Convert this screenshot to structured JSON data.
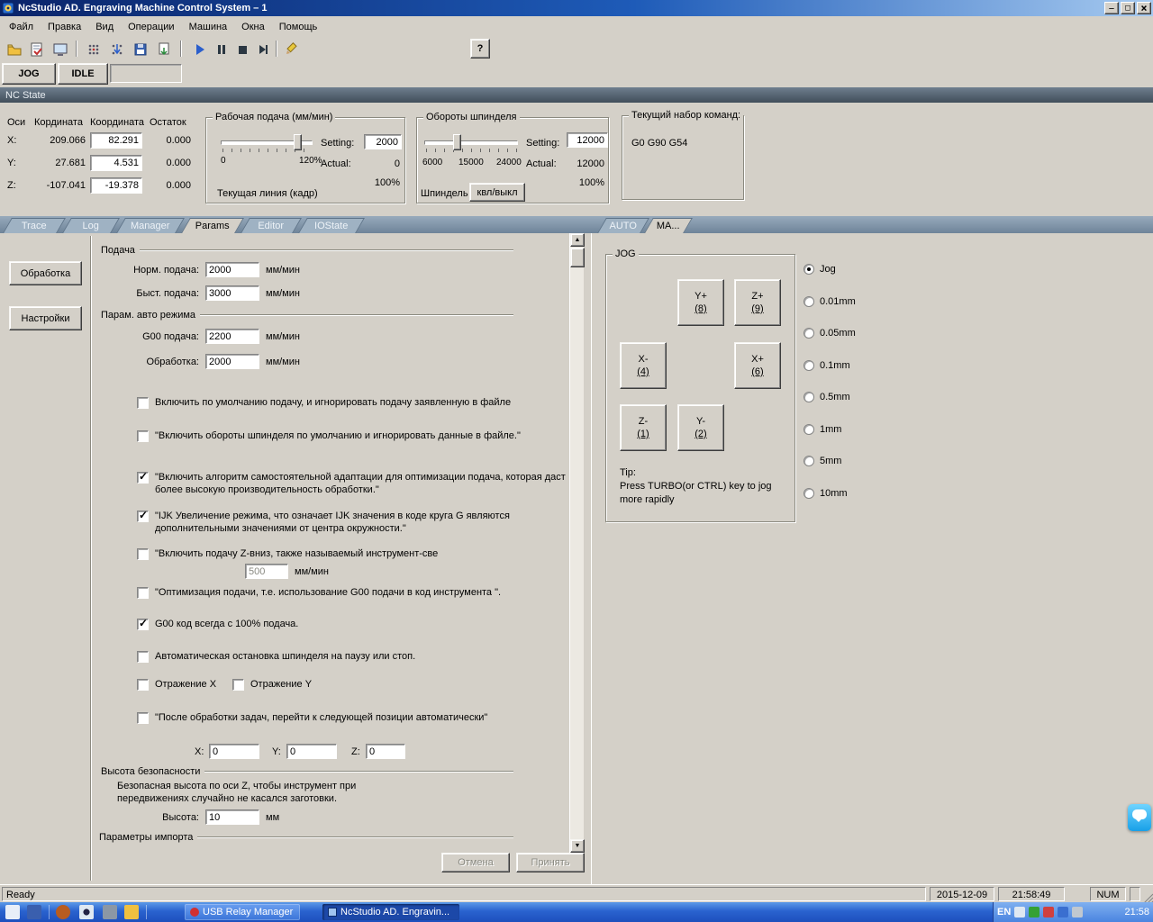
{
  "colors": {
    "titlebar_dark": "#0a246a",
    "titlebar_light": "#a6caf0",
    "ncstate_top": "#6e7e8e",
    "ncstate_bottom": "#414e5a",
    "tab_bar": "#6f8499",
    "taskbar": "#2a63cf"
  },
  "window": {
    "title": "NcStudio AD. Engraving Machine Control System  – 1"
  },
  "menu": {
    "items": [
      {
        "label": "Файл"
      },
      {
        "label": "Правка"
      },
      {
        "label": "Вид"
      },
      {
        "label": "Операции"
      },
      {
        "label": "Машина"
      },
      {
        "label": "Окна"
      },
      {
        "label": "Помощь"
      }
    ]
  },
  "toolbar": {
    "coord_x": "X0",
    "coord_y": "Y",
    "coord_z": "Z",
    "help_label": "?"
  },
  "modes": {
    "jog": "JOG",
    "idle": "IDLE"
  },
  "nc_state": {
    "title": "NC State"
  },
  "coords": {
    "col_axis": "Оси",
    "col_machine": "Кордината",
    "col_work": "Координата",
    "col_rest": "Остаток",
    "rows": [
      {
        "axis": "X:",
        "machine": "209.066",
        "work": "82.291",
        "rest": "0.000"
      },
      {
        "axis": "Y:",
        "machine": "27.681",
        "work": "4.531",
        "rest": "0.000"
      },
      {
        "axis": "Z:",
        "machine": "-107.041",
        "work": "-19.378",
        "rest": "0.000"
      }
    ]
  },
  "feed": {
    "title": "Рабочая подача (мм/мин)",
    "scale_min": "0",
    "scale_max": "120%",
    "setting_label": "Setting:",
    "setting_value": "2000",
    "actual_label": "Actual:",
    "actual_value": "0",
    "override": "100%",
    "current_line_label": "Текущая линия (кадр)"
  },
  "spindle": {
    "title": "Обороты шпинделя",
    "ticks": [
      "6000",
      "15000",
      "24000"
    ],
    "setting_label": "Setting:",
    "setting_value": "12000",
    "actual_label": "Actual:",
    "actual_value": "12000",
    "override": "100%",
    "name_label": "Шпиндель",
    "toggle_label": "квл/выкл"
  },
  "commands": {
    "title": "Текущий набор команд:",
    "value": "G0 G90 G54"
  },
  "left_tabs": [
    {
      "label": "Trace",
      "active": false
    },
    {
      "label": "Log",
      "active": false
    },
    {
      "label": "Manager",
      "active": false
    },
    {
      "label": "Params",
      "active": true
    },
    {
      "label": "Editor",
      "active": false
    },
    {
      "label": "IOState",
      "active": false
    }
  ],
  "side_buttons": [
    {
      "label": "Обработка"
    },
    {
      "label": "Настройки"
    }
  ],
  "params": {
    "section_feed": "Подача",
    "fields": [
      {
        "label": "Норм. подача:",
        "value": "2000",
        "unit": "мм/мин"
      },
      {
        "label": "Быст. подача:",
        "value": "3000",
        "unit": "мм/мин"
      }
    ],
    "section_auto": "Парам. авто режима",
    "auto_fields": [
      {
        "label": "G00 подача:",
        "value": "2200",
        "unit": "мм/мин"
      },
      {
        "label": "Обработка:",
        "value": "2000",
        "unit": "мм/мин"
      }
    ],
    "checkboxes": [
      {
        "checked": false,
        "label": "Включить по умолчанию подачу, и игнорировать подачу заявленную в файле"
      },
      {
        "checked": false,
        "label": "\"Включить обороты шпинделя по умолчанию и игнорировать данные в файле.\""
      },
      {
        "checked": true,
        "label": "\"Включить алгоритм самостоятельной адаптации для оптимизации подача, которая даст более высокую производительность обработки.\""
      },
      {
        "checked": true,
        "label": "\"IJK Увеличение режима, что означает IJK значения в коде круга G являются дополнительными значениями от центра окружности.\""
      },
      {
        "checked": false,
        "label": "\"Включить подачу Z-вниз, также называемый инструмент-све"
      },
      {
        "checked": false,
        "label": "\"Оптимизация подачи, т.е. использование G00 подачи в код инструмента \"."
      },
      {
        "checked": true,
        "label": "G00 код всегда с 100% подача."
      },
      {
        "checked": false,
        "label": "Автоматическая остановка шпинделя на паузу или стоп."
      },
      {
        "checked": false,
        "label": "Отражение  X"
      },
      {
        "checked": false,
        "label": "Отражение Y"
      },
      {
        "checked": false,
        "label": "\"После обработки задач, перейти к следующей позиции автоматически\""
      }
    ],
    "zdown_value": "500",
    "zdown_unit": "мм/мин",
    "next_pos": [
      {
        "label": "X:",
        "value": "0"
      },
      {
        "label": "Y:",
        "value": "0"
      },
      {
        "label": "Z:",
        "value": "0"
      }
    ],
    "section_safe": "Высота безопасности",
    "safe_desc": "Безопасная высота по оси Z, чтобы инструмент при передвижениях случайно не касался заготовки.",
    "safe_height_label": "Высота:",
    "safe_height_value": "10",
    "safe_height_unit": "мм",
    "section_import": "Параметры импорта",
    "cancel_label": "Отмена",
    "apply_label": "Принять"
  },
  "right_tabs": [
    {
      "label": "AUTO",
      "active": false
    },
    {
      "label": "MA...",
      "active": true
    }
  ],
  "jog": {
    "group_title": "JOG",
    "buttons": [
      {
        "axis": "Y+",
        "key": "(8)"
      },
      {
        "axis": "Z+",
        "key": "(9)"
      },
      {
        "axis": "X-",
        "key": "(4)"
      },
      {
        "axis": "X+",
        "key": "(6)"
      },
      {
        "axis": "Z-",
        "key": "(1)"
      },
      {
        "axis": "Y-",
        "key": "(2)"
      }
    ],
    "tip_title": "Tip:",
    "tip_text": "Press TURBO(or CTRL) key to jog more rapidly",
    "steps": [
      {
        "label": "Jog",
        "selected": true
      },
      {
        "label": "0.01mm",
        "selected": false
      },
      {
        "label": "0.05mm",
        "selected": false
      },
      {
        "label": "0.1mm",
        "selected": false
      },
      {
        "label": "0.5mm",
        "selected": false
      },
      {
        "label": "1mm",
        "selected": false
      },
      {
        "label": "5mm",
        "selected": false
      },
      {
        "label": "10mm",
        "selected": false
      }
    ]
  },
  "statusbar": {
    "ready": "Ready",
    "date": "2015-12-09",
    "time": "21:58:49",
    "num": "NUM"
  },
  "taskbar": {
    "tasks": [
      {
        "label": "USB Relay Manager",
        "active": false
      },
      {
        "label": "NcStudio AD. Engravin...",
        "active": true
      }
    ],
    "lang": "EN",
    "clock": "21:58"
  }
}
